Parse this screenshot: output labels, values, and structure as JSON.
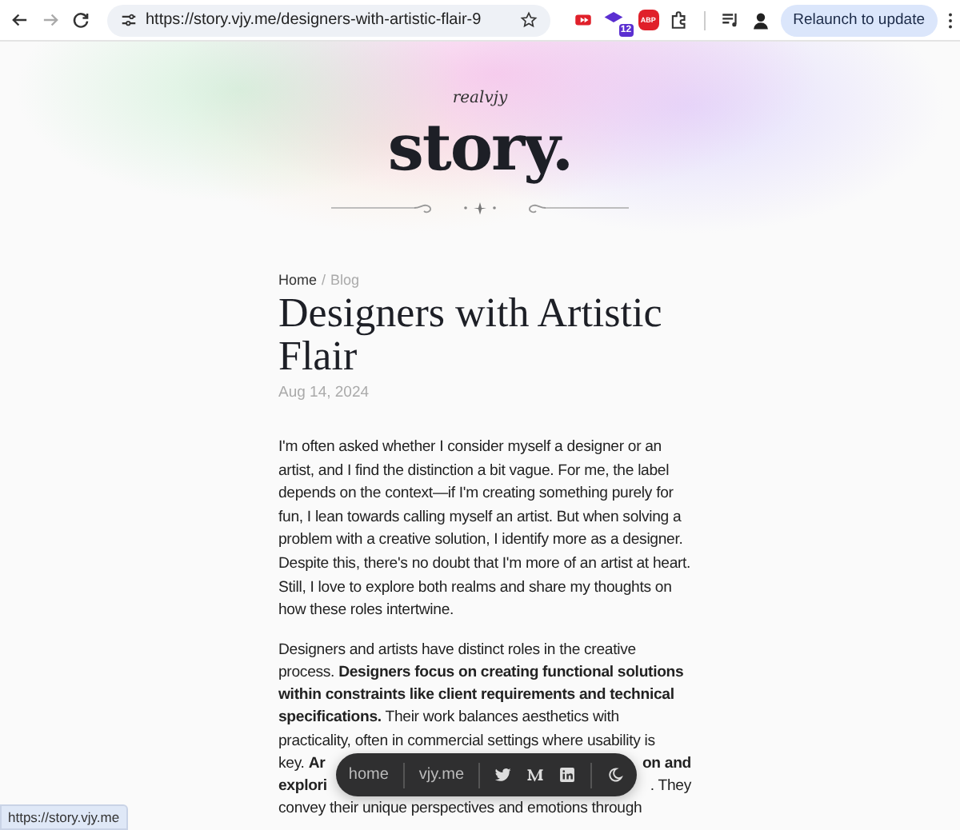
{
  "browser": {
    "url": "https://story.vjy.me/designers-with-artistic-flair-9",
    "forward_disabled": true,
    "extension_badge": "12",
    "adblock_label": "ABP",
    "relaunch_button": "Relaunch to update"
  },
  "header": {
    "signature": "realvjy",
    "logo": "story."
  },
  "breadcrumb": {
    "home": "Home",
    "separator": "/",
    "current": "Blog"
  },
  "article": {
    "title": "Designers with Artistic Flair",
    "date": "Aug 14, 2024",
    "paragraph_1": "I'm often asked whether I consider myself a designer or an artist, and I find the distinction a bit vague. For me, the label depends on the context—if I'm creating something purely for fun, I lean towards calling myself an artist. But when solving a problem with a creative solution, I identify more as a designer. Despite this, there's no doubt that I'm more of an artist at heart. Still, I love to explore both realms and share my thoughts on how these roles intertwine.",
    "paragraph_2_lines": [
      {
        "left": "Designers and artists have distinct roles in the creative"
      },
      {
        "left": "process. **Designers focus on creating functional solutions**"
      },
      {
        "left": "**within constraints like client requirements and technical**"
      },
      {
        "left": "**specifications.** Their work balances aesthetics with"
      },
      {
        "left": "practicality, often in commercial settings where usability is"
      },
      {
        "left": "key. **Ar**",
        "right": "**on and**"
      },
      {
        "left": "**explori**",
        "right": ". They"
      },
      {
        "left": "convey their unique perspectives and emotions through"
      }
    ]
  },
  "floating_nav": {
    "links": [
      "home",
      "vjy.me"
    ],
    "icons": [
      {
        "kind": "twitter"
      },
      {
        "kind": "medium"
      },
      {
        "kind": "linkedin"
      }
    ],
    "theme_toggle": {
      "kind": "moon"
    }
  },
  "status_url": "https://story.vjy.me"
}
